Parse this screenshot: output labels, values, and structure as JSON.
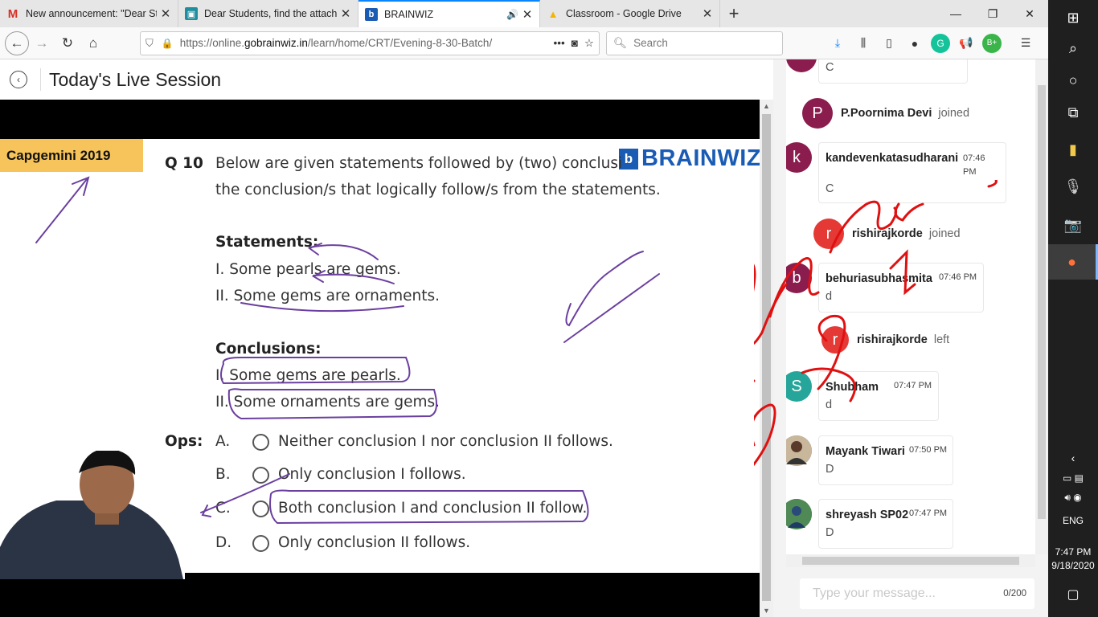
{
  "browser": {
    "tabs": [
      {
        "title": "New announcement: \"Dear Stu",
        "favicon": "gmail-icon",
        "active": false
      },
      {
        "title": "Dear Students, find the attache",
        "favicon": "classroom-icon",
        "active": false
      },
      {
        "title": "BRAINWIZ",
        "favicon": "brainwiz-icon",
        "active": true
      },
      {
        "title": "Classroom - Google Drive",
        "favicon": "drive-icon",
        "active": false
      }
    ],
    "url_prefix": "https://online.",
    "url_domain": "gobrainwiz.in",
    "url_path": "/learn/home/CRT/Evening-8-30-Batch/",
    "search_placeholder": "Search"
  },
  "page": {
    "title": "Today's Live Session"
  },
  "slide": {
    "tag": "Capgemini 2019",
    "logo_letter": "b",
    "logo_text": "BRAINWIZ",
    "question_number": "Q 10",
    "question_line1": "Below are given statements followed by (two) conclusi",
    "question_line2": "the conclusion/s that logically follow/s from the statements.",
    "statements_heading": "Statements:",
    "statements": [
      "I. Some pearls are gems.",
      "II. Some gems are ornaments."
    ],
    "conclusions_heading": "Conclusions:",
    "conclusions": [
      "I. Some gems are pearls.",
      "II. Some ornaments are gems."
    ],
    "options_label": "Ops:",
    "options": [
      {
        "letter": "A.",
        "text": "Neither conclusion I nor conclusion II follows."
      },
      {
        "letter": "B.",
        "text": "Only conclusion I follows."
      },
      {
        "letter": "C.",
        "text": "Both conclusion I and conclusion II follow."
      },
      {
        "letter": "D.",
        "text": "Only conclusion II follows."
      }
    ]
  },
  "chat": {
    "top_partial_text": "C",
    "events": [
      {
        "type": "join",
        "initial": "P",
        "name": "P.Poornima Devi",
        "status": "joined",
        "color": "#8b1c4e"
      },
      {
        "type": "msg",
        "initial": "k",
        "name": "kandevenkatasudharani",
        "time": "07:46 PM",
        "text": "C",
        "color": "#8b1c4e"
      },
      {
        "type": "join",
        "initial": "r",
        "name": "rishirajkorde",
        "status": "joined",
        "color": "#e53935"
      },
      {
        "type": "msg",
        "initial": "b",
        "name": "behuriasubhasmita",
        "time": "07:46 PM",
        "text": "d",
        "color": "#8b1c4e"
      },
      {
        "type": "join",
        "initial": "r",
        "name": "rishirajkorde",
        "status": "left",
        "color": "#e53935"
      },
      {
        "type": "msg",
        "initial": "S",
        "name": "Shubham",
        "time": "07:47 PM",
        "text": "d",
        "color": "#26a69a"
      },
      {
        "type": "msg",
        "initial": "",
        "name": "Mayank Tiwari",
        "time": "07:50 PM",
        "text": "D",
        "color": "#6d6d6d"
      },
      {
        "type": "msg",
        "initial": "",
        "name": "shreyash SP02",
        "time": "07:47 PM",
        "text": "D",
        "color": "#2e6b3a"
      }
    ],
    "input_placeholder": "Type your message...",
    "char_count": "0/200"
  },
  "taskbar": {
    "language": "ENG",
    "time": "7:47 PM",
    "date": "9/18/2020"
  }
}
